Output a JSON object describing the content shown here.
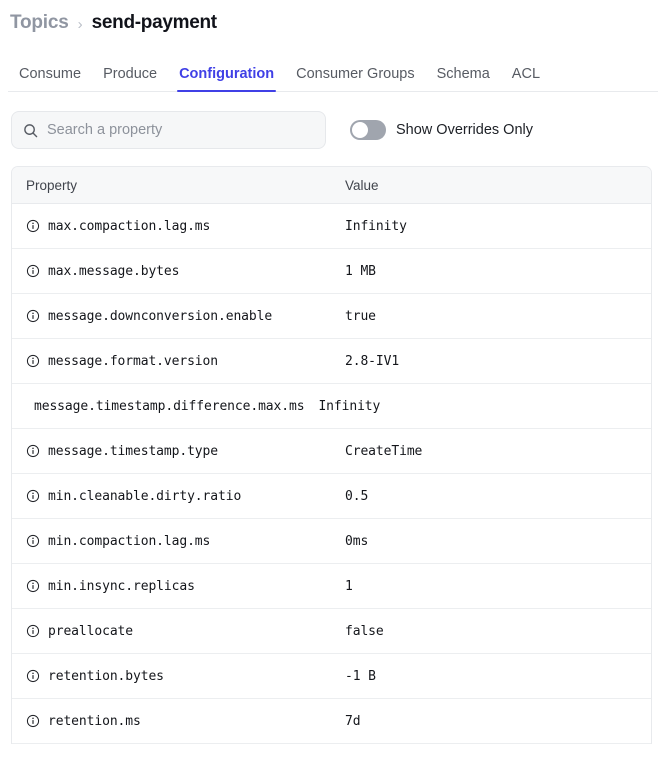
{
  "breadcrumb": {
    "root": "Topics",
    "separator": "›",
    "current": "send-payment"
  },
  "tabs": [
    {
      "label": "Consume",
      "active": false
    },
    {
      "label": "Produce",
      "active": false
    },
    {
      "label": "Configuration",
      "active": true
    },
    {
      "label": "Consumer Groups",
      "active": false
    },
    {
      "label": "Schema",
      "active": false
    },
    {
      "label": "ACL",
      "active": false
    }
  ],
  "filters": {
    "search_placeholder": "Search a property",
    "search_value": "",
    "search_icon": "search-icon",
    "toggle_label": "Show Overrides Only",
    "toggle_on": false
  },
  "table": {
    "columns": [
      "Property",
      "Value"
    ],
    "info_icon": "info-circle-icon",
    "rows": [
      {
        "property": "max.compaction.lag.ms",
        "value": "Infinity",
        "has_info_icon": true
      },
      {
        "property": "max.message.bytes",
        "value": "1 MB",
        "has_info_icon": true
      },
      {
        "property": "message.downconversion.enable",
        "value": "true",
        "has_info_icon": true
      },
      {
        "property": "message.format.version",
        "value": "2.8-IV1",
        "has_info_icon": true
      },
      {
        "property": "message.timestamp.difference.max.ms",
        "value": "Infinity",
        "has_info_icon": false
      },
      {
        "property": "message.timestamp.type",
        "value": "CreateTime",
        "has_info_icon": true
      },
      {
        "property": "min.cleanable.dirty.ratio",
        "value": "0.5",
        "has_info_icon": true
      },
      {
        "property": "min.compaction.lag.ms",
        "value": "0ms",
        "has_info_icon": true
      },
      {
        "property": "min.insync.replicas",
        "value": "1",
        "has_info_icon": true
      },
      {
        "property": "preallocate",
        "value": "false",
        "has_info_icon": true
      },
      {
        "property": "retention.bytes",
        "value": "-1 B",
        "has_info_icon": true
      },
      {
        "property": "retention.ms",
        "value": "7d",
        "has_info_icon": true
      }
    ]
  },
  "colors": {
    "accent": "#4040e6",
    "header_bg": "#f7f8f9",
    "border": "#e8eaed",
    "text": "#14161b",
    "muted": "#8d929b"
  }
}
